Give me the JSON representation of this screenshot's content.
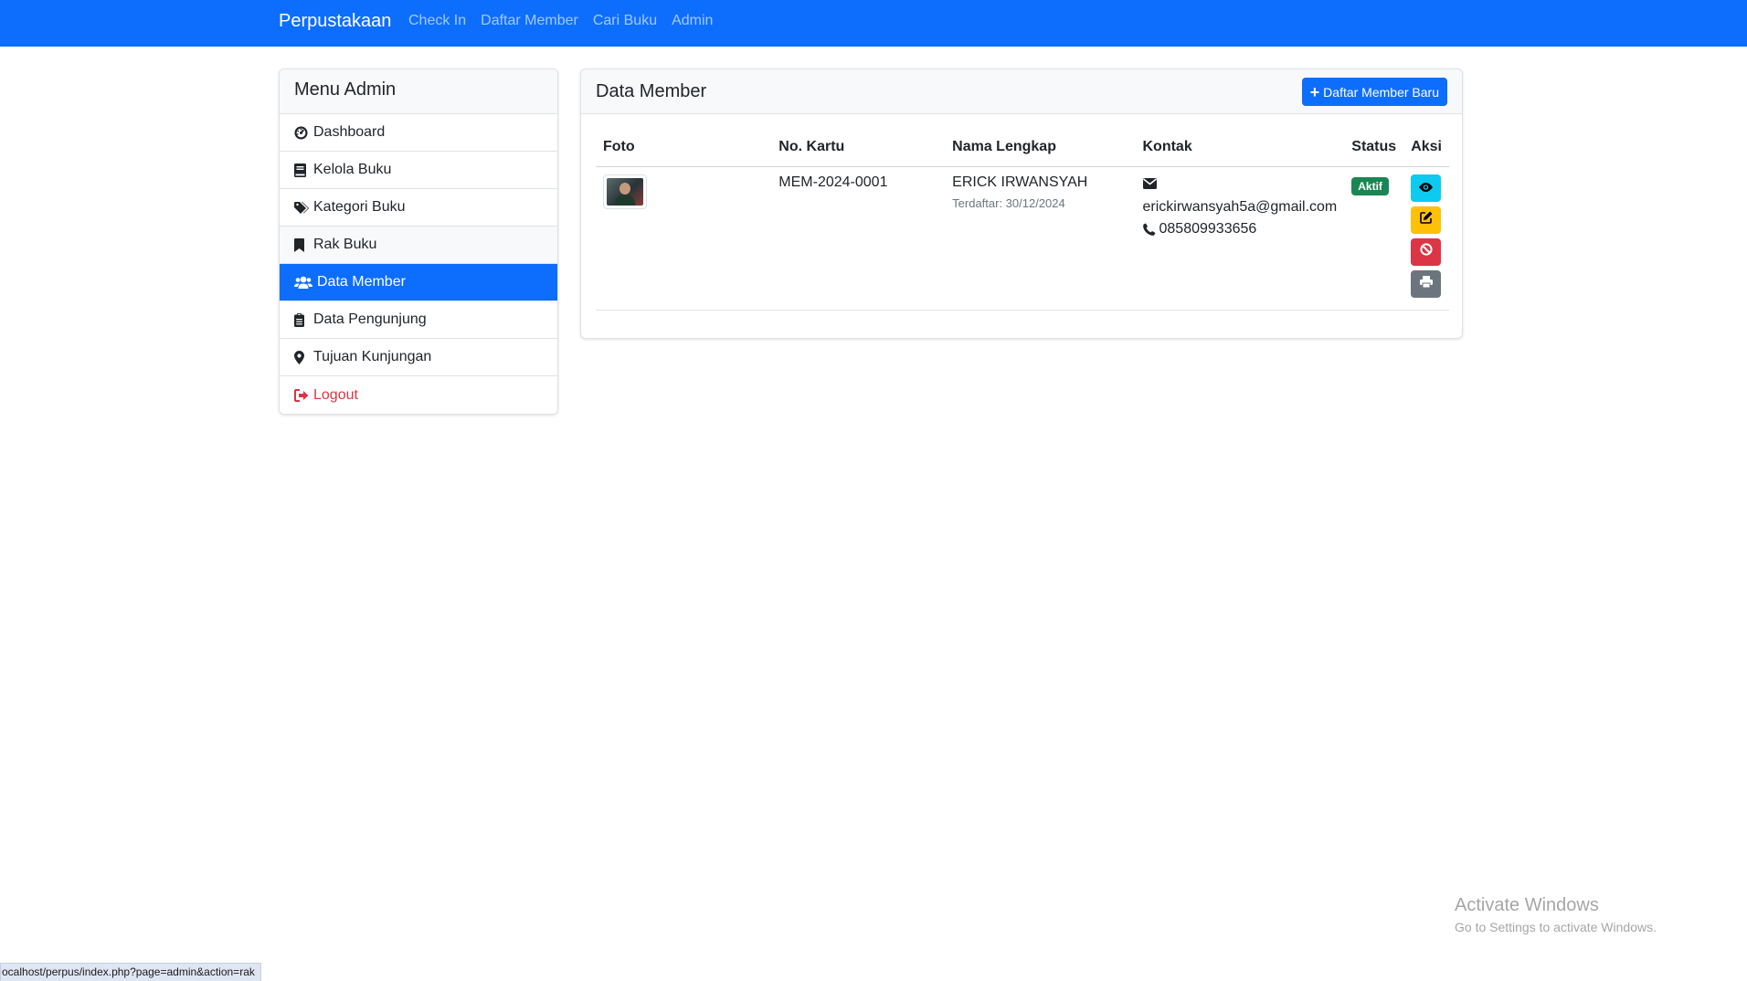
{
  "navbar": {
    "brand": "Perpustakaan",
    "links": [
      "Check In",
      "Daftar Member",
      "Cari Buku",
      "Admin"
    ],
    "bg_color": "#0d6efd"
  },
  "sidebar": {
    "title": "Menu Admin",
    "items": [
      {
        "label": "Dashboard",
        "icon": "tachometer-icon"
      },
      {
        "label": "Kelola Buku",
        "icon": "book-icon"
      },
      {
        "label": "Kategori Buku",
        "icon": "tags-icon"
      },
      {
        "label": "Rak Buku",
        "icon": "bookmark-icon"
      },
      {
        "label": "Data Member",
        "icon": "users-icon",
        "active": true
      },
      {
        "label": "Data Pengunjung",
        "icon": "clipboard-icon"
      },
      {
        "label": "Tujuan Kunjungan",
        "icon": "map-marker-icon"
      },
      {
        "label": "Logout",
        "icon": "sign-out-icon",
        "color": "#dc3545"
      }
    ]
  },
  "main": {
    "title": "Data Member",
    "add_button": "Daftar Member Baru",
    "table": {
      "headers": [
        "Foto",
        "No. Kartu",
        "Nama Lengkap",
        "Kontak",
        "Status",
        "Aksi"
      ],
      "rows": [
        {
          "card_no": "MEM-2024-0001",
          "name": "ERICK IRWANSYAH",
          "registered": "Terdaftar: 30/12/2024",
          "email": "erickirwansyah5a@gmail.com",
          "phone": "085809933656",
          "status": "Aktif",
          "status_color": "#198754",
          "actions": [
            {
              "icon": "eye-icon",
              "color": "#0dcaf0"
            },
            {
              "icon": "edit-icon",
              "color": "#ffc107"
            },
            {
              "icon": "ban-icon",
              "color": "#dc3545"
            },
            {
              "icon": "print-icon",
              "color": "#6c757d"
            }
          ]
        }
      ]
    }
  },
  "watermark": {
    "title": "Activate Windows",
    "subtitle": "Go to Settings to activate Windows."
  },
  "statusbar": {
    "url": "ocalhost/perpus/index.php?page=admin&action=rak"
  }
}
